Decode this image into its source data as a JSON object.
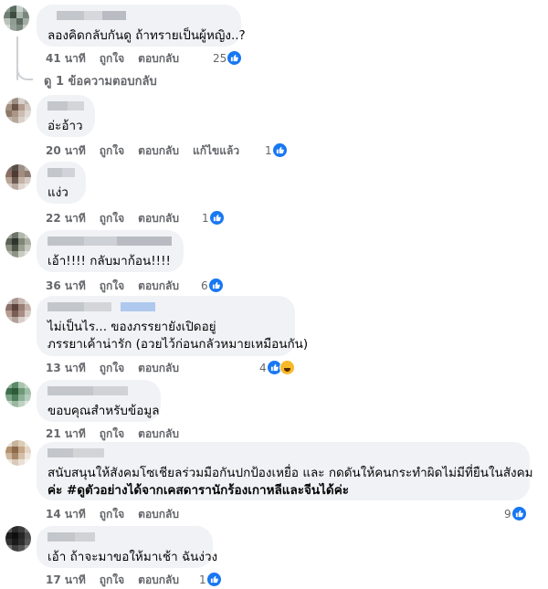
{
  "colors": {
    "like_blue": "#1877f2",
    "bubble_bg": "#f0f2f5",
    "meta_gray": "#65676b"
  },
  "labels": {
    "like": "ถูกใจ",
    "reply": "ตอบกลับ",
    "edited": "แก้ไขแล้ว"
  },
  "view_replies": "ดู 1 ข้อความตอบกลับ",
  "comments": [
    {
      "id": "c1",
      "text": "ลองคิดกลับกันดู ถ้าทรายเป็นผู้หญิง..?",
      "time": "41 นาที",
      "reactions": "25",
      "reaction_icons": [
        "like-icon"
      ]
    },
    {
      "id": "c2",
      "text": "อ่ะอ้าว",
      "time": "20 นาที",
      "edited": true,
      "reactions": "1",
      "reaction_icons": [
        "like-icon"
      ]
    },
    {
      "id": "c3",
      "text": "แง่ว",
      "time": "22 นาที",
      "reactions": "1",
      "reaction_icons": [
        "like-icon"
      ]
    },
    {
      "id": "c4",
      "text": "เอ้า!!!! กลับมาก้อน!!!!",
      "time": "36 นาที",
      "reactions": "6",
      "reaction_icons": [
        "like-icon"
      ]
    },
    {
      "id": "c5",
      "text_lines": [
        "ไม่เป็นไร... ของภรรยายังเปิดอยู่",
        "ภรรยาเค้าน่ารัก (อวยไว้ก่อนกลัวหมายเหมือนกัน)"
      ],
      "time": "13 นาที",
      "reactions": "4",
      "reaction_icons": [
        "like-icon",
        "haha-icon"
      ]
    },
    {
      "id": "c6",
      "text": "ขอบคุณสำหรับข้อมูล",
      "time": "21 นาที",
      "reactions": "",
      "reaction_icons": []
    },
    {
      "id": "c7",
      "text_lines": [
        "สนับสนุนให้สังคมโซเชียลร่วมมือกันปกป้องเหยื่อ และ กดดันให้คนกระทำผิดไม่มีที่ยืนในสังคม",
        "ค่ะ #ดูตัวอย่างได้จากเคสดารานักร้องเกาหลีและจีนได้ค่ะ"
      ],
      "time": "14 นาที",
      "reactions": "9",
      "reaction_icons": [
        "like-icon"
      ]
    },
    {
      "id": "c8",
      "text": "เอ้า ถ้าจะมาขอให้มาเช้า ฉันง่วง",
      "time": "17 นาที",
      "reactions": "1",
      "reaction_icons": [
        "like-icon"
      ]
    }
  ]
}
